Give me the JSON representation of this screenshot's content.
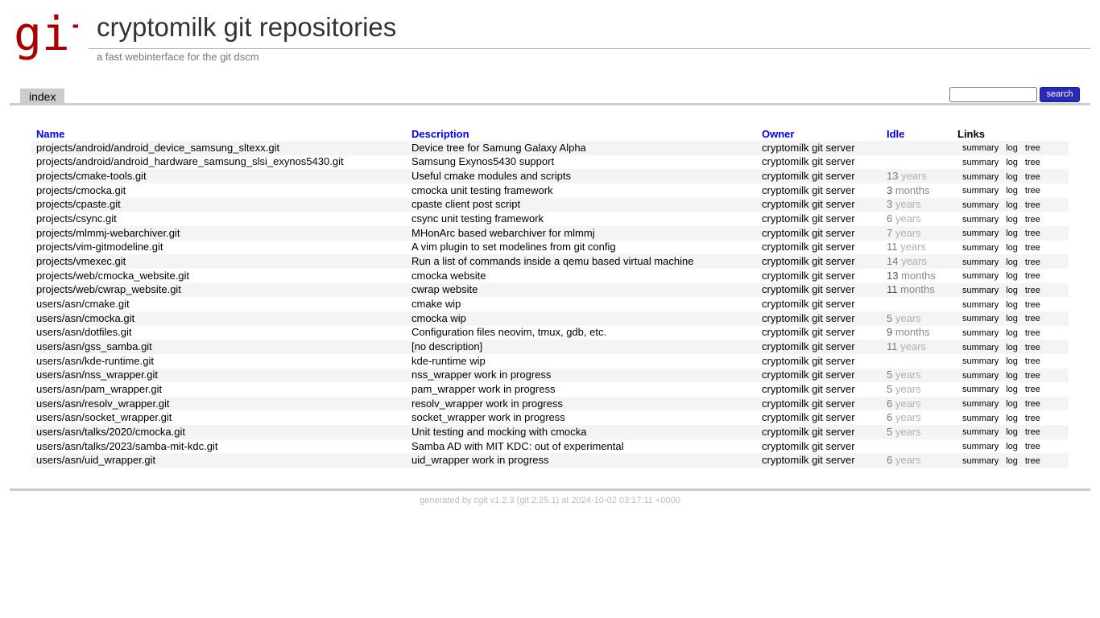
{
  "header": {
    "logo_text": "git",
    "title": "cryptomilk git repositories",
    "subtitle": "a fast webinterface for the git dscm"
  },
  "tabs": {
    "index_label": "index"
  },
  "search": {
    "value": "",
    "button_label": "search"
  },
  "colors": {
    "logo": "#aa0000",
    "link": "#0000ee",
    "search_button": "#2a2ab8"
  },
  "table": {
    "headers": {
      "name": "Name",
      "description": "Description",
      "owner": "Owner",
      "idle": "Idle",
      "links": "Links"
    },
    "link_labels": {
      "summary": "summary",
      "log": "log",
      "tree": "tree"
    },
    "rows": [
      {
        "name": "projects/android/android_device_samsung_sltexx.git",
        "description": "Device tree for Samung Galaxy Alpha",
        "owner": "cryptomilk git server",
        "idle_num": "",
        "idle_unit": ""
      },
      {
        "name": "projects/android/android_hardware_samsung_slsi_exynos5430.git",
        "description": "Samsung Exynos5430 support",
        "owner": "cryptomilk git server",
        "idle_num": "",
        "idle_unit": ""
      },
      {
        "name": "projects/cmake-tools.git",
        "description": "Useful cmake modules and scripts",
        "owner": "cryptomilk git server",
        "idle_num": "13",
        "idle_unit": " years"
      },
      {
        "name": "projects/cmocka.git",
        "description": "cmocka unit testing framework",
        "owner": "cryptomilk git server",
        "idle_num": "3",
        "idle_unit": " months"
      },
      {
        "name": "projects/cpaste.git",
        "description": "cpaste client post script",
        "owner": "cryptomilk git server",
        "idle_num": "3",
        "idle_unit": " years"
      },
      {
        "name": "projects/csync.git",
        "description": "csync unit testing framework",
        "owner": "cryptomilk git server",
        "idle_num": "6",
        "idle_unit": " years"
      },
      {
        "name": "projects/mlmmj-webarchiver.git",
        "description": "MHonArc based webarchiver for mlmmj",
        "owner": "cryptomilk git server",
        "idle_num": "7",
        "idle_unit": " years"
      },
      {
        "name": "projects/vim-gitmodeline.git",
        "description": "A vim plugin to set modelines from git config",
        "owner": "cryptomilk git server",
        "idle_num": "11",
        "idle_unit": " years"
      },
      {
        "name": "projects/vmexec.git",
        "description": "Run a list of commands inside a qemu based virtual machine",
        "owner": "cryptomilk git server",
        "idle_num": "14",
        "idle_unit": " years"
      },
      {
        "name": "projects/web/cmocka_website.git",
        "description": "cmocka website",
        "owner": "cryptomilk git server",
        "idle_num": "13",
        "idle_unit": " months"
      },
      {
        "name": "projects/web/cwrap_website.git",
        "description": "cwrap website",
        "owner": "cryptomilk git server",
        "idle_num": "11",
        "idle_unit": " months"
      },
      {
        "name": "users/asn/cmake.git",
        "description": "cmake wip",
        "owner": "cryptomilk git server",
        "idle_num": "",
        "idle_unit": ""
      },
      {
        "name": "users/asn/cmocka.git",
        "description": "cmocka wip",
        "owner": "cryptomilk git server",
        "idle_num": "5",
        "idle_unit": " years"
      },
      {
        "name": "users/asn/dotfiles.git",
        "description": "Configuration files neovim, tmux, gdb, etc.",
        "owner": "cryptomilk git server",
        "idle_num": "9",
        "idle_unit": " months"
      },
      {
        "name": "users/asn/gss_samba.git",
        "description": "[no description]",
        "owner": "cryptomilk git server",
        "idle_num": "11",
        "idle_unit": " years"
      },
      {
        "name": "users/asn/kde-runtime.git",
        "description": "kde-runtime wip",
        "owner": "cryptomilk git server",
        "idle_num": "",
        "idle_unit": ""
      },
      {
        "name": "users/asn/nss_wrapper.git",
        "description": "nss_wrapper work in progress",
        "owner": "cryptomilk git server",
        "idle_num": "5",
        "idle_unit": " years"
      },
      {
        "name": "users/asn/pam_wrapper.git",
        "description": "pam_wrapper work in progress",
        "owner": "cryptomilk git server",
        "idle_num": "5",
        "idle_unit": " years"
      },
      {
        "name": "users/asn/resolv_wrapper.git",
        "description": "resolv_wrapper work in progress",
        "owner": "cryptomilk git server",
        "idle_num": "6",
        "idle_unit": " years"
      },
      {
        "name": "users/asn/socket_wrapper.git",
        "description": "socket_wrapper work in progress",
        "owner": "cryptomilk git server",
        "idle_num": "6",
        "idle_unit": " years"
      },
      {
        "name": "users/asn/talks/2020/cmocka.git",
        "description": "Unit testing and mocking with cmocka",
        "owner": "cryptomilk git server",
        "idle_num": "5",
        "idle_unit": " years"
      },
      {
        "name": "users/asn/talks/2023/samba-mit-kdc.git",
        "description": "Samba AD with MIT KDC: out of experimental",
        "owner": "cryptomilk git server",
        "idle_num": "",
        "idle_unit": ""
      },
      {
        "name": "users/asn/uid_wrapper.git",
        "description": "uid_wrapper work in progress",
        "owner": "cryptomilk git server",
        "idle_num": "6",
        "idle_unit": " years"
      }
    ]
  },
  "footer": {
    "prefix": "generated by ",
    "cgit_link": "cgit v1.2.3",
    "middle_open": " (",
    "git_link": "git 2.25.1",
    "suffix": ") at 2024-10-02 03:17:11 +0000"
  }
}
